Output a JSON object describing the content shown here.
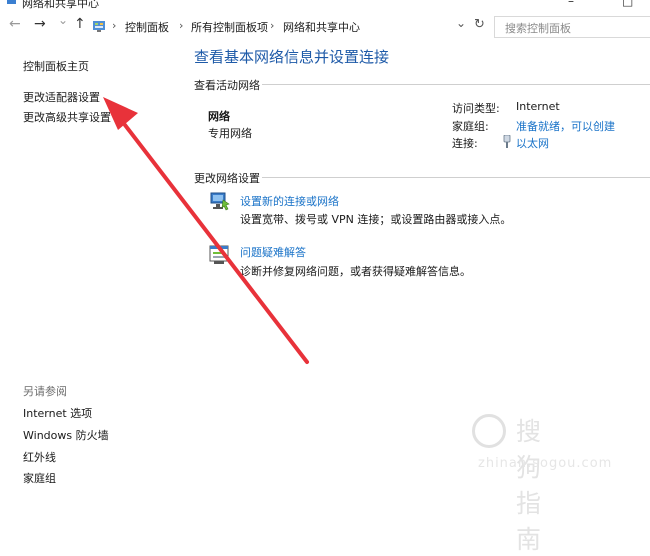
{
  "window": {
    "title": "网络和共享中心",
    "minimize_glyph": "–",
    "maximize_glyph": "□"
  },
  "nav": {
    "back_glyph": "←",
    "forward_glyph": "→",
    "dropdown_glyph": "⌄",
    "up_glyph": "↑",
    "breadcrumb": [
      "控制面板",
      "所有控制面板项",
      "网络和共享中心"
    ],
    "breadcrumb_sep": "›",
    "addr_dropdown_glyph": "⌄",
    "refresh_glyph": "↻"
  },
  "search": {
    "placeholder": "搜索控制面板"
  },
  "sidebar": {
    "items": [
      {
        "label": "控制面板主页"
      },
      {
        "label": "更改适配器设置"
      },
      {
        "label": "更改高级共享设置"
      }
    ],
    "see_also_title": "另请参阅",
    "see_also": [
      {
        "label": "Internet 选项"
      },
      {
        "label": "Windows 防火墙"
      },
      {
        "label": "红外线"
      },
      {
        "label": "家庭组"
      }
    ]
  },
  "main": {
    "title": "查看基本网络信息并设置连接",
    "active_networks_heading": "查看活动网络",
    "network": {
      "name": "网络",
      "type": "专用网络",
      "access_type_label": "访问类型:",
      "access_type_value": "Internet",
      "homegroup_label": "家庭组:",
      "homegroup_value": "准备就绪，可以创建",
      "connections_label": "连接:",
      "connections_value": "以太网"
    },
    "change_settings_heading": "更改网络设置",
    "actions": [
      {
        "title": "设置新的连接或网络",
        "desc": "设置宽带、拨号或 VPN 连接；或设置路由器或接入点。"
      },
      {
        "title": "问题疑难解答",
        "desc": "诊断并修复网络问题，或者获得疑难解答信息。"
      }
    ]
  },
  "watermark": {
    "brand": "搜狗指南",
    "domain": "zhinan.sogou.com"
  },
  "colors": {
    "link": "#1a73c8",
    "title": "#1e5aa8",
    "arrow": "#e8323a"
  }
}
